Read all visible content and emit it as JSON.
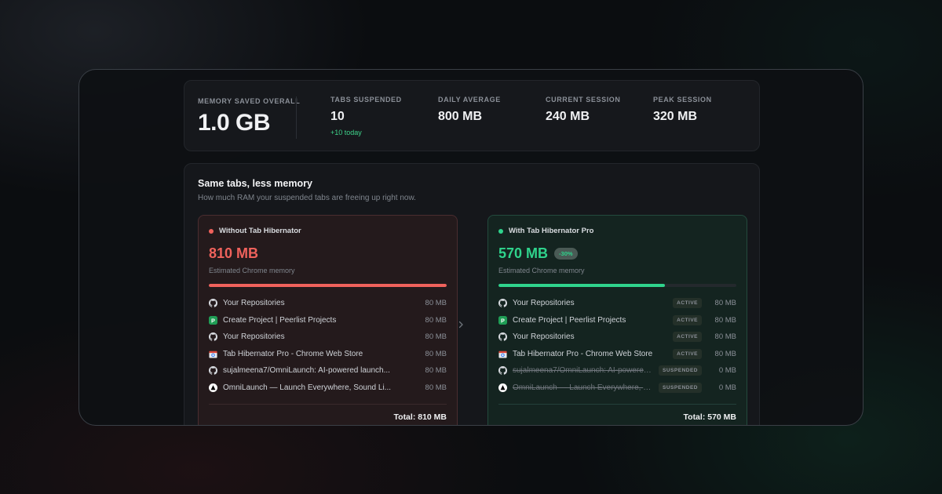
{
  "stats": {
    "overall": {
      "label": "MEMORY SAVED OVERALL",
      "value": "1.0 GB"
    },
    "tabs_suspended": {
      "label": "TABS SUSPENDED",
      "value": "10",
      "delta": "+10 today"
    },
    "daily_average": {
      "label": "DAILY AVERAGE",
      "value": "800 MB"
    },
    "current_session": {
      "label": "CURRENT SESSION",
      "value": "240 MB"
    },
    "peak_session": {
      "label": "PEAK SESSION",
      "value": "320 MB"
    }
  },
  "panel": {
    "title": "Same tabs, less memory",
    "subtitle": "How much RAM your suspended tabs are freeing up right now."
  },
  "without": {
    "heading": "Without Tab Hibernator",
    "amount": "810 MB",
    "caption": "Estimated Chrome memory",
    "fill_fraction": 1.0,
    "accent": "#f0625c",
    "total": "Total: 810 MB",
    "tabs": [
      {
        "icon": "github-icon",
        "title": "Your Repositories",
        "mb": "80 MB"
      },
      {
        "icon": "peerlist-icon",
        "title": "Create Project | Peerlist Projects",
        "mb": "80 MB"
      },
      {
        "icon": "github-icon",
        "title": "Your Repositories",
        "mb": "80 MB"
      },
      {
        "icon": "chrome-web-store-icon",
        "title": "Tab Hibernator Pro - Chrome Web Store",
        "mb": "80 MB"
      },
      {
        "icon": "github-icon",
        "title": "sujalmeena7/OmniLaunch: AI-powered launch...",
        "mb": "80 MB"
      },
      {
        "icon": "omnilaunch-icon",
        "title": "OmniLaunch — Launch Everywhere, Sound Li...",
        "mb": "80 MB"
      }
    ]
  },
  "with": {
    "heading": "With Tab Hibernator Pro",
    "amount": "570 MB",
    "badge": "-30%",
    "caption": "Estimated Chrome memory",
    "fill_fraction": 0.7,
    "accent": "#2fd38c",
    "total": "Total: 570 MB",
    "tabs": [
      {
        "icon": "github-icon",
        "title": "Your Repositories",
        "status": "ACTIVE",
        "mb": "80 MB",
        "suspended": false
      },
      {
        "icon": "peerlist-icon",
        "title": "Create Project | Peerlist Projects",
        "status": "ACTIVE",
        "mb": "80 MB",
        "suspended": false
      },
      {
        "icon": "github-icon",
        "title": "Your Repositories",
        "status": "ACTIVE",
        "mb": "80 MB",
        "suspended": false
      },
      {
        "icon": "chrome-web-store-icon",
        "title": "Tab Hibernator Pro - Chrome Web Store",
        "status": "ACTIVE",
        "mb": "80 MB",
        "suspended": false
      },
      {
        "icon": "github-icon",
        "title": "sujalmeena7/OmniLaunch: AI-powered la...",
        "status": "SUSPENDED",
        "mb": "0 MB",
        "suspended": true
      },
      {
        "icon": "omnilaunch-icon",
        "title": "OmniLaunch — Launch Everywhere, Sou...",
        "status": "SUSPENDED",
        "mb": "0 MB",
        "suspended": true
      }
    ]
  }
}
